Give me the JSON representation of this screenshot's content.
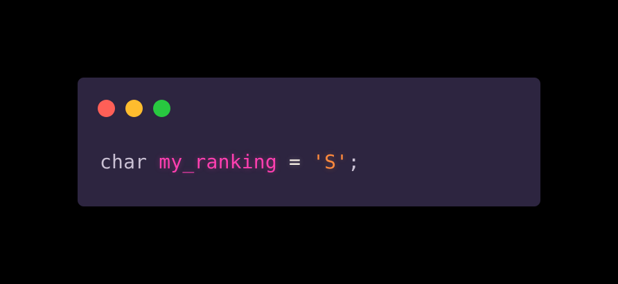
{
  "window": {
    "controls": [
      {
        "name": "close",
        "color": "#ff5f57",
        "icon": "close-dot-icon"
      },
      {
        "name": "minimize",
        "color": "#febc2e",
        "icon": "minimize-dot-icon"
      },
      {
        "name": "zoom",
        "color": "#28c840",
        "icon": "zoom-dot-icon"
      }
    ]
  },
  "code": {
    "keyword": "char",
    "identifier": "my_ranking",
    "operator": "=",
    "string": "'S'",
    "terminator": ";"
  },
  "colors": {
    "background": "#000000",
    "window": "#2d2540",
    "keyword": "#c9c0d3",
    "identifier": "#ff3fb0",
    "operator": "#f6efe4",
    "string": "#ff8a3d"
  }
}
